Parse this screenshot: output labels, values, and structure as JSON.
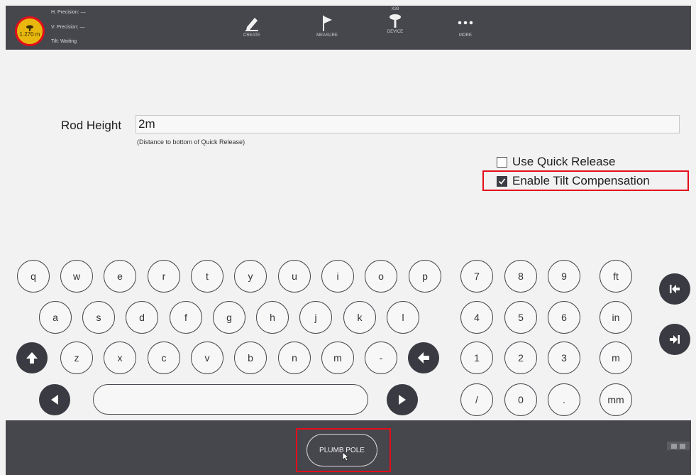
{
  "status": {
    "badge_text": "1.270 m",
    "h_precision": "H. Precision: —",
    "v_precision": "V. Precision: —",
    "tilt": "Tilt: Waiting"
  },
  "toolbar": {
    "create": "CREATE",
    "measure": "MEASURE",
    "device_top": "X39",
    "device": "DEVICE",
    "more": "MORE"
  },
  "form": {
    "rod_height_label": "Rod Height",
    "rod_height_value": "2m",
    "rod_height_hint": "(Distance to bottom of Quick Release)",
    "use_quick_release": "Use Quick Release",
    "use_quick_release_checked": false,
    "enable_tilt": "Enable Tilt Compensation",
    "enable_tilt_checked": true
  },
  "keyboard": {
    "row1": [
      "q",
      "w",
      "e",
      "r",
      "t",
      "y",
      "u",
      "i",
      "o",
      "p"
    ],
    "row2": [
      "a",
      "s",
      "d",
      "f",
      "g",
      "h",
      "j",
      "k",
      "l"
    ],
    "row3": [
      "z",
      "x",
      "c",
      "v",
      "b",
      "n",
      "m",
      "-"
    ],
    "numpad": [
      "7",
      "8",
      "9",
      "4",
      "5",
      "6",
      "1",
      "2",
      "3",
      "/",
      "0",
      "."
    ],
    "units": [
      "ft",
      "in",
      "m",
      "mm"
    ]
  },
  "bottom": {
    "plumb_pole": "PLUMB POLE"
  }
}
